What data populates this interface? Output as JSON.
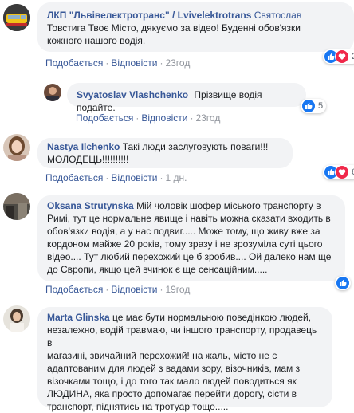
{
  "actions": {
    "like": "Подобається",
    "reply": "Відповісти",
    "sep": "·"
  },
  "comments": [
    {
      "author": "ЛКП \"Львівелектротранс\" / Lvivelektrotrans",
      "text_lines": [
        "Святослав",
        "Товстига Твоє Місто, дякуємо за відео! Буденні обов'язки",
        "кожного нашого водія."
      ],
      "time": "23год",
      "reactions": {
        "types": [
          "like",
          "love"
        ],
        "count": "2"
      }
    },
    {
      "author": "Svyatoslav Vlashchenko",
      "text": "Прізвище водія подайте.",
      "time": "23год",
      "reactions": {
        "types": [
          "like"
        ],
        "count": "5"
      }
    },
    {
      "author": "Nastya Ilchenko",
      "text_lines": [
        "Такі люди заслуговують поваги!!!",
        "МОЛОДЕЦЬ!!!!!!!!!!"
      ],
      "time": "1 дн.",
      "reactions": {
        "types": [
          "like",
          "love"
        ],
        "count": "6"
      }
    },
    {
      "author": "Oksana Strutynska",
      "text_lines": [
        "Мій чоловік шофер міського транспорту в",
        "Римі, тут це нормальне явище і навіть можна сказати входить в",
        "обов'язки водія, а у нас подвиг..... Може тому, що живу вже за",
        "кордоном майже 20 років, тому зразу і не зрозуміла суті цього",
        "відео.... Тут любий перехожий це б зробив.... Ой далеко нам ще",
        "до Європи, якщо цей вчинок є ще сенсаційним....."
      ],
      "time": "19год",
      "reactions": {
        "types": [
          "like"
        ],
        "count": ""
      }
    },
    {
      "author": "Marta Glinska",
      "text_lines": [
        "це має бути нормальною поведінкою людей,",
        "незалежно, водій травмаю, чи іншого транспорту, продавець в",
        "магазині, звичайний перехожий! на жаль, місто не є",
        "адаптованим для людей з вадами зору, візочників, мам з",
        "візочками тощо, і до того так мало людей поводиться як",
        "ЛЮДИНА, яка просто допомагає перейти дорогу, сісти в",
        "транспорт, піднятись на тротуар тощо....."
      ]
    }
  ]
}
